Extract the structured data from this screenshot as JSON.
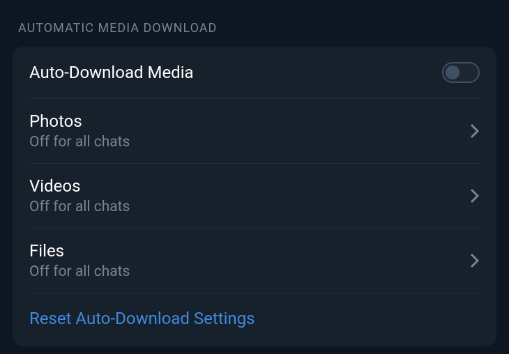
{
  "section": {
    "header": "AUTOMATIC MEDIA DOWNLOAD"
  },
  "auto_download": {
    "label": "Auto-Download Media",
    "enabled": false
  },
  "items": [
    {
      "title": "Photos",
      "subtitle": "Off for all chats"
    },
    {
      "title": "Videos",
      "subtitle": "Off for all chats"
    },
    {
      "title": "Files",
      "subtitle": "Off for all chats"
    }
  ],
  "reset": {
    "label": "Reset Auto-Download Settings"
  }
}
